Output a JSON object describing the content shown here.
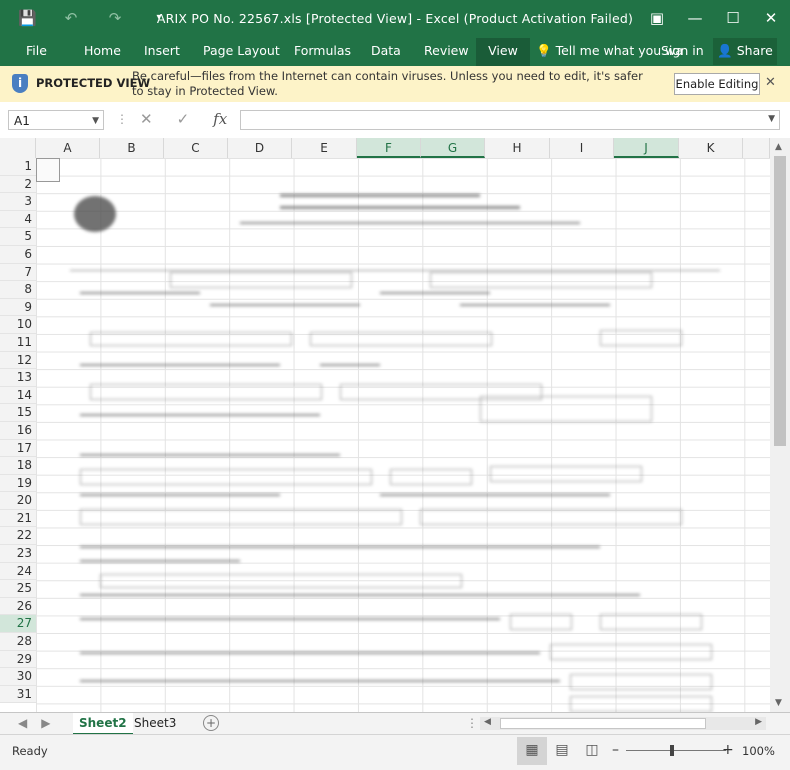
{
  "window": {
    "title": "ARIX PO No. 22567.xls  [Protected View] - Excel (Product Activation Failed)",
    "accent": "#217346"
  },
  "qat": {
    "icons": [
      "save-icon",
      "undo-icon",
      "redo-icon",
      "customize-icon"
    ]
  },
  "ribbon": {
    "tabs": [
      "File",
      "Home",
      "Insert",
      "Page Layout",
      "Formulas",
      "Data",
      "Review",
      "View"
    ],
    "active_tab": "View",
    "tell_me": "Tell me what you wa",
    "sign_in": "Sign in",
    "share": "Share"
  },
  "protected_view": {
    "label": "PROTECTED VIEW",
    "message": "Be careful—files from the Internet can contain viruses. Unless you need to edit, it's safer to stay in Protected View.",
    "button": "Enable Editing",
    "bg_color": "#fdf3c8"
  },
  "formula_bar": {
    "name_box": "A1",
    "fx": "fx",
    "value": ""
  },
  "grid": {
    "columns": [
      "A",
      "B",
      "C",
      "D",
      "E",
      "F",
      "G",
      "H",
      "I",
      "J",
      "K"
    ],
    "selected_columns": [
      "F",
      "G",
      "J"
    ],
    "rows": [
      "1",
      "2",
      "3",
      "4",
      "5",
      "6",
      "7",
      "8",
      "9",
      "10",
      "11",
      "12",
      "13",
      "14",
      "15",
      "16",
      "17",
      "18",
      "19",
      "20",
      "21",
      "22",
      "23",
      "24",
      "25",
      "26",
      "27",
      "28",
      "29",
      "30",
      "31"
    ],
    "selected_row": "27"
  },
  "sheets": {
    "tabs": [
      "Sheet2",
      "Sheet3"
    ],
    "active": "Sheet2"
  },
  "status": {
    "ready": "Ready",
    "zoom": "100%"
  }
}
